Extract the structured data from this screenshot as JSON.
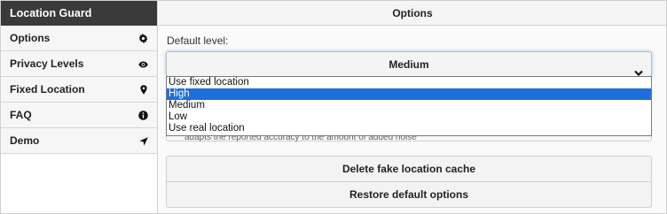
{
  "sidebar": {
    "title": "Location Guard",
    "items": [
      {
        "label": "Options",
        "icon": "gear-icon"
      },
      {
        "label": "Privacy Levels",
        "icon": "eye-icon"
      },
      {
        "label": "Fixed Location",
        "icon": "map-pin-icon"
      },
      {
        "label": "FAQ",
        "icon": "info-icon"
      },
      {
        "label": "Demo",
        "icon": "location-arrow-icon"
      }
    ]
  },
  "main": {
    "title": "Options",
    "default_level_label": "Default level:",
    "select_value": "Medium",
    "dropdown_options": [
      "Use fixed location",
      "High",
      "Medium",
      "Low",
      "Use real location"
    ],
    "highlighted_option": "High",
    "partial_text": "adapts the reported accuracy to the amount of added noise",
    "buttons": {
      "delete_cache": "Delete fake location cache",
      "restore_defaults": "Restore default options"
    }
  },
  "colors": {
    "sidebar_header_bg": "#3a3a3a",
    "selection_blue": "#1e6fd9",
    "focus_glow": "#9ec6ea"
  }
}
